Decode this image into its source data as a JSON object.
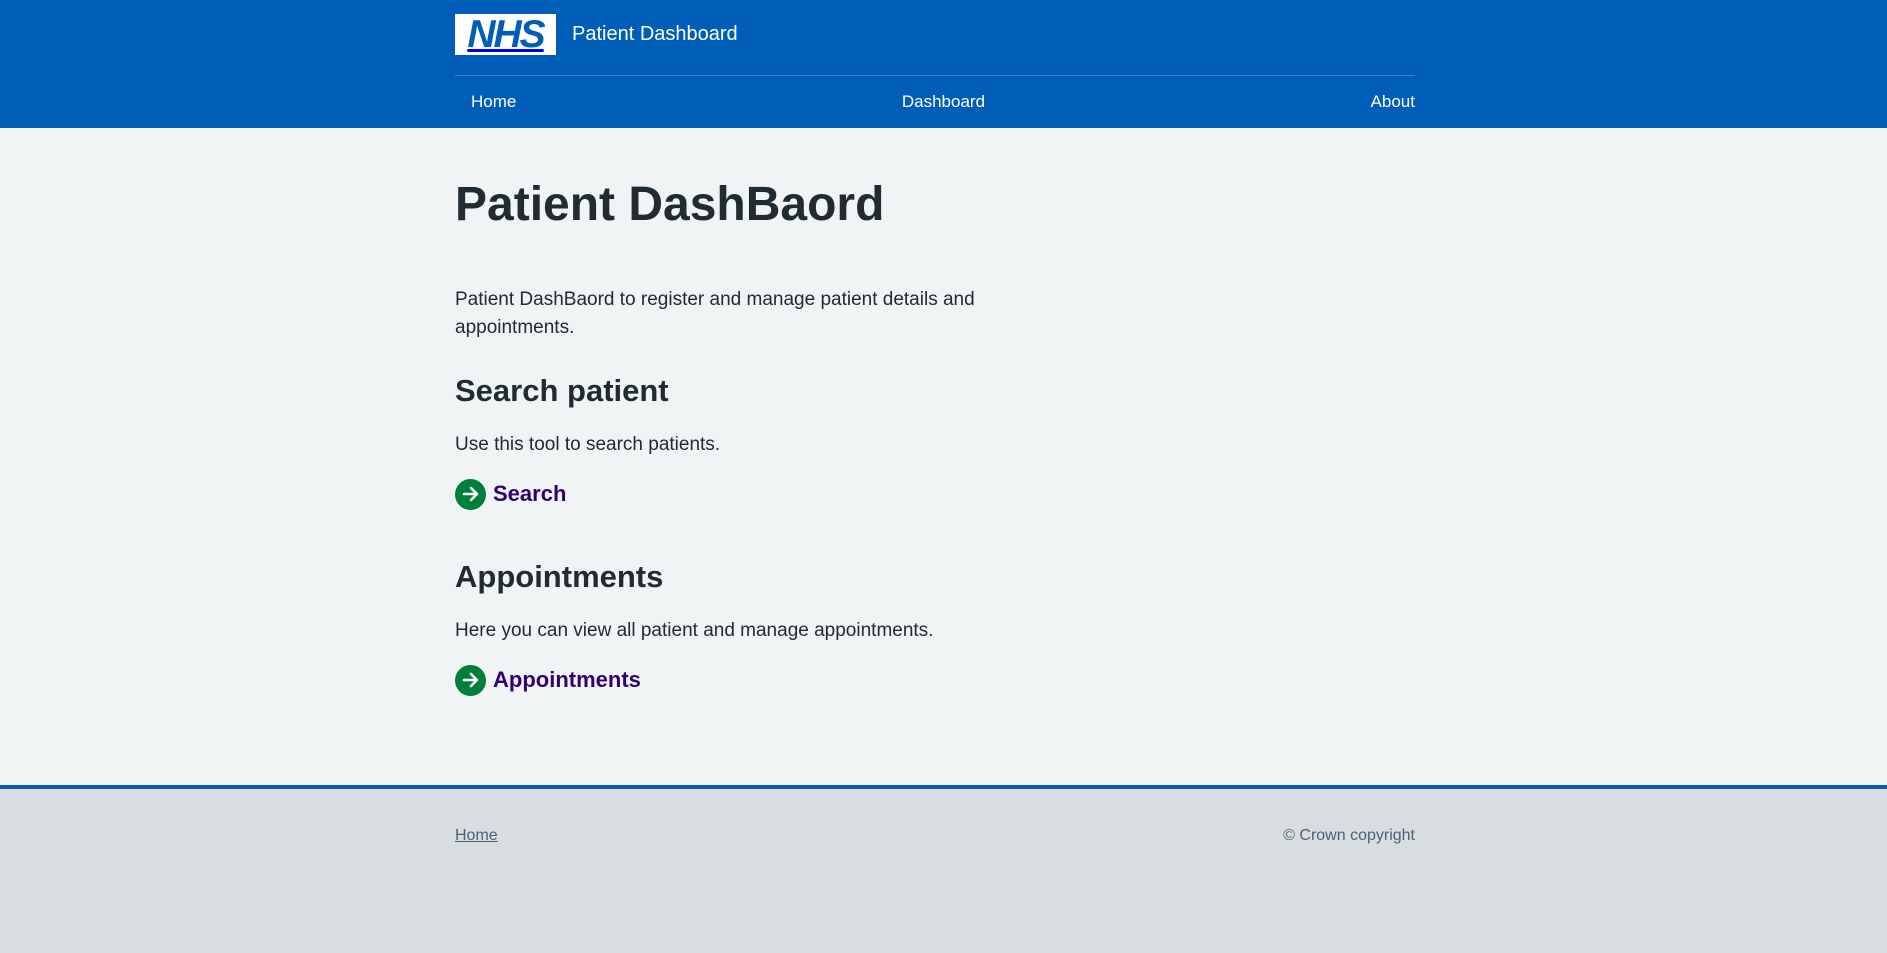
{
  "header": {
    "logo_text": "NHS",
    "service_name": "Patient Dashboard",
    "brand_color": "#005eb8"
  },
  "nav": {
    "items": [
      {
        "label": "Home"
      },
      {
        "label": "Dashboard"
      },
      {
        "label": "About"
      }
    ]
  },
  "main": {
    "title": "Patient DashBaord",
    "lede": "Patient DashBaord to register and manage patient details and appointments.",
    "sections": [
      {
        "heading": "Search patient",
        "text": "Use this tool to search patients.",
        "action_label": "Search",
        "action_icon": "arrow-right-circle-icon"
      },
      {
        "heading": "Appointments",
        "text": "Here you can view all patient and manage appointments.",
        "action_label": "Appointments",
        "action_icon": "arrow-right-circle-icon"
      }
    ],
    "action_icon_color": "#007f3b",
    "action_link_color": "#330072"
  },
  "footer": {
    "link_label": "Home",
    "copyright": "© Crown copyright"
  }
}
